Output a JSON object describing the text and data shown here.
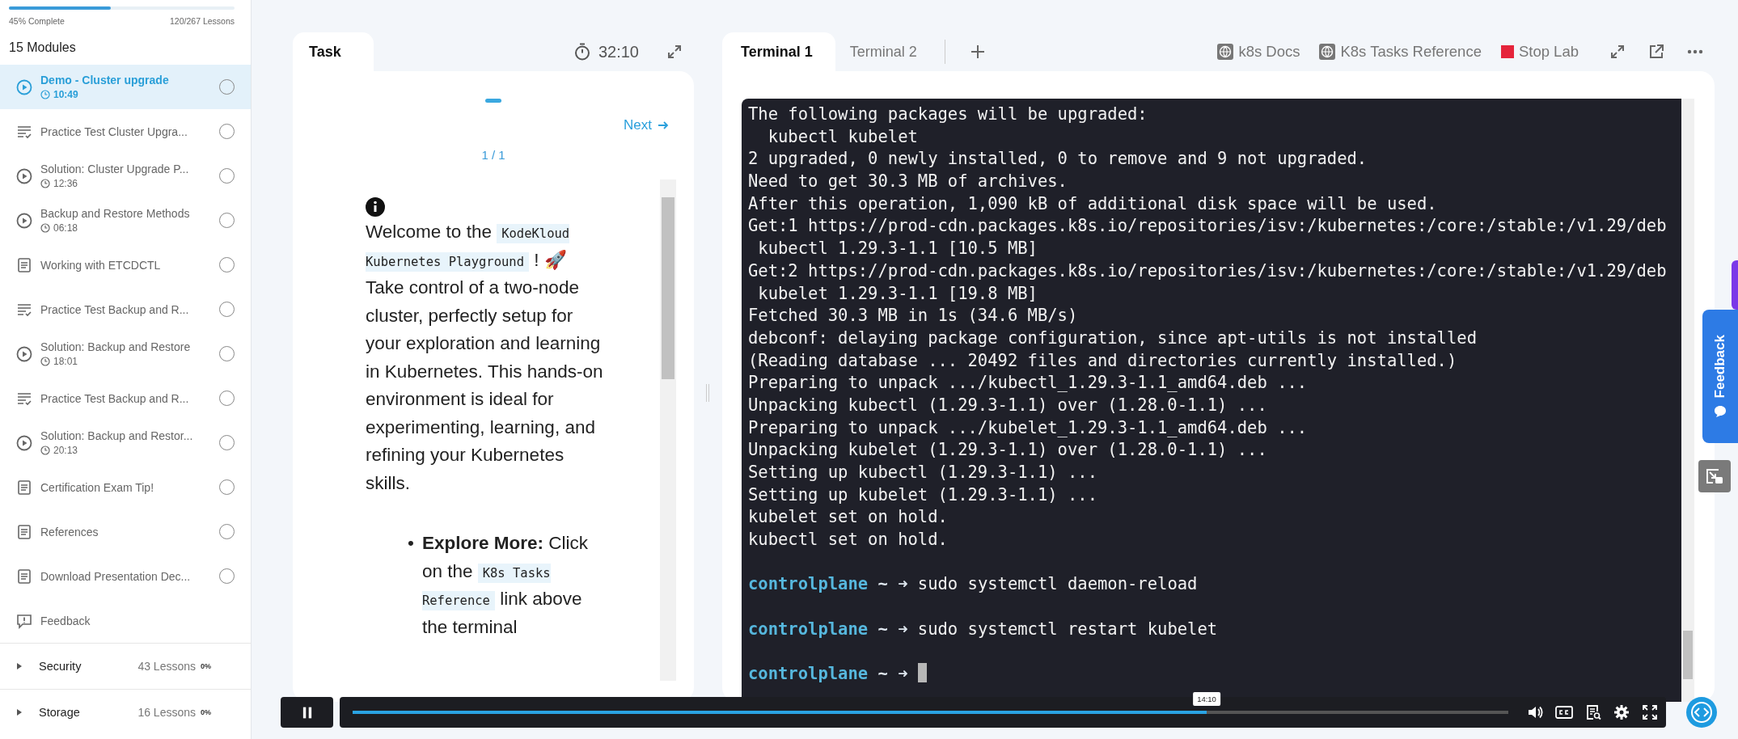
{
  "sidebar": {
    "progress": {
      "level": 0.45,
      "label": "45% Complete",
      "lessons": "120/267 Lessons"
    },
    "modules_heading": "15 Modules",
    "items": [
      {
        "kind": "video",
        "title": "Demo - Cluster upgrade",
        "duration": "10:49",
        "selected": true
      },
      {
        "kind": "quiz",
        "title": "Practice Test Cluster Upgra...",
        "selected": false
      },
      {
        "kind": "video",
        "title": "Solution: Cluster Upgrade P...",
        "duration": "12:36",
        "selected": false
      },
      {
        "kind": "video",
        "title": "Backup and Restore Methods",
        "duration": "06:18",
        "selected": false
      },
      {
        "kind": "doc",
        "title": "Working with ETCDCTL",
        "selected": false
      },
      {
        "kind": "quiz",
        "title": "Practice Test Backup and R...",
        "selected": false
      },
      {
        "kind": "video",
        "title": "Solution: Backup and Restore",
        "duration": "18:01",
        "selected": false
      },
      {
        "kind": "quiz",
        "title": "Practice Test Backup and R...",
        "selected": false
      },
      {
        "kind": "video",
        "title": "Solution: Backup and Restor...",
        "duration": "20:13",
        "selected": false
      },
      {
        "kind": "doc",
        "title": "Certification Exam Tip!",
        "selected": false
      },
      {
        "kind": "doc",
        "title": "References",
        "selected": false
      },
      {
        "kind": "doc",
        "title": "Download Presentation Dec...",
        "selected": false
      },
      {
        "kind": "feedback",
        "title": "Feedback",
        "selected": false
      }
    ],
    "sections": [
      {
        "title": "Security",
        "lessons": "43 Lessons",
        "percent": "0%"
      },
      {
        "title": "Storage",
        "lessons": "16 Lessons",
        "percent": "0%"
      }
    ]
  },
  "task_panel": {
    "tab": "Task",
    "timer": "32:10",
    "next": "Next",
    "page": "1 / 1",
    "intro": [
      {
        "kind": "text",
        "text": "Welcome to the "
      },
      {
        "kind": "code",
        "text": "KodeKloud Kubernetes Playground"
      },
      {
        "kind": "text",
        "text": " ! 🚀 Take control of a two-node cluster, perfectly setup for your exploration and learning in Kubernetes. This hands-on environment is ideal for experimenting, learning, and refining your Kubernetes skills."
      }
    ],
    "bullets": [
      {
        "marker": "•",
        "segments": [
          {
            "kind": "text",
            "text": "**Explore More:** Click on the "
          },
          {
            "kind": "code",
            "text": "K8s Tasks Reference"
          },
          {
            "kind": "text",
            "text": " link above the terminal"
          }
        ]
      }
    ]
  },
  "terminal_panel": {
    "tabs": [
      {
        "label": "Terminal 1",
        "selected": true
      },
      {
        "label": "Terminal 2",
        "selected": false
      }
    ],
    "links": [
      {
        "kind": "globe",
        "label": "k8s Docs"
      },
      {
        "kind": "globe",
        "label": "K8s Tasks Reference"
      },
      {
        "kind": "stop",
        "label": "Stop Lab"
      }
    ],
    "lines": [
      {
        "kind": "output",
        "text": "The following packages will be upgraded:"
      },
      {
        "kind": "output",
        "text": "  kubectl kubelet"
      },
      {
        "kind": "output",
        "text": "2 upgraded, 0 newly installed, 0 to remove and 9 not upgraded."
      },
      {
        "kind": "output",
        "text": "Need to get 30.3 MB of archives."
      },
      {
        "kind": "output",
        "text": "After this operation, 1,090 kB of additional disk space will be used."
      },
      {
        "kind": "output",
        "text": "Get:1 https://prod-cdn.packages.k8s.io/repositories/isv:/kubernetes:/core:/stable:/v1.29/deb"
      },
      {
        "kind": "output",
        "text": " kubectl 1.29.3-1.1 [10.5 MB]"
      },
      {
        "kind": "output",
        "text": "Get:2 https://prod-cdn.packages.k8s.io/repositories/isv:/kubernetes:/core:/stable:/v1.29/deb"
      },
      {
        "kind": "output",
        "text": " kubelet 1.29.3-1.1 [19.8 MB]"
      },
      {
        "kind": "output",
        "text": "Fetched 30.3 MB in 1s (34.6 MB/s)"
      },
      {
        "kind": "output",
        "text": "debconf: delaying package configuration, since apt-utils is not installed"
      },
      {
        "kind": "output",
        "text": "(Reading database ... 20492 files and directories currently installed.)"
      },
      {
        "kind": "output",
        "text": "Preparing to unpack .../kubectl_1.29.3-1.1_amd64.deb ..."
      },
      {
        "kind": "output",
        "text": "Unpacking kubectl (1.29.3-1.1) over (1.28.0-1.1) ..."
      },
      {
        "kind": "output",
        "text": "Preparing to unpack .../kubelet_1.29.3-1.1_amd64.deb ..."
      },
      {
        "kind": "output",
        "text": "Unpacking kubelet (1.29.3-1.1) over (1.28.0-1.1) ..."
      },
      {
        "kind": "output",
        "text": "Setting up kubectl (1.29.3-1.1) ..."
      },
      {
        "kind": "output",
        "text": "Setting up kubelet (1.29.3-1.1) ..."
      },
      {
        "kind": "output",
        "text": "kubelet set on hold."
      },
      {
        "kind": "output",
        "text": "kubectl set on hold."
      },
      {
        "kind": "blank"
      },
      {
        "kind": "prompt",
        "host": "controlplane",
        "symbol": "~ ➜",
        "command": "sudo systemctl daemon-reload"
      },
      {
        "kind": "blank"
      },
      {
        "kind": "prompt",
        "host": "controlplane",
        "symbol": "~ ➜",
        "command": "sudo systemctl restart kubelet"
      },
      {
        "kind": "blank"
      },
      {
        "kind": "prompt",
        "host": "controlplane",
        "symbol": "~ ➜",
        "cursor": true
      }
    ]
  },
  "player": {
    "playing": true,
    "level": 0.739,
    "time": "14:10"
  },
  "feedback_tab": "Feedback"
}
